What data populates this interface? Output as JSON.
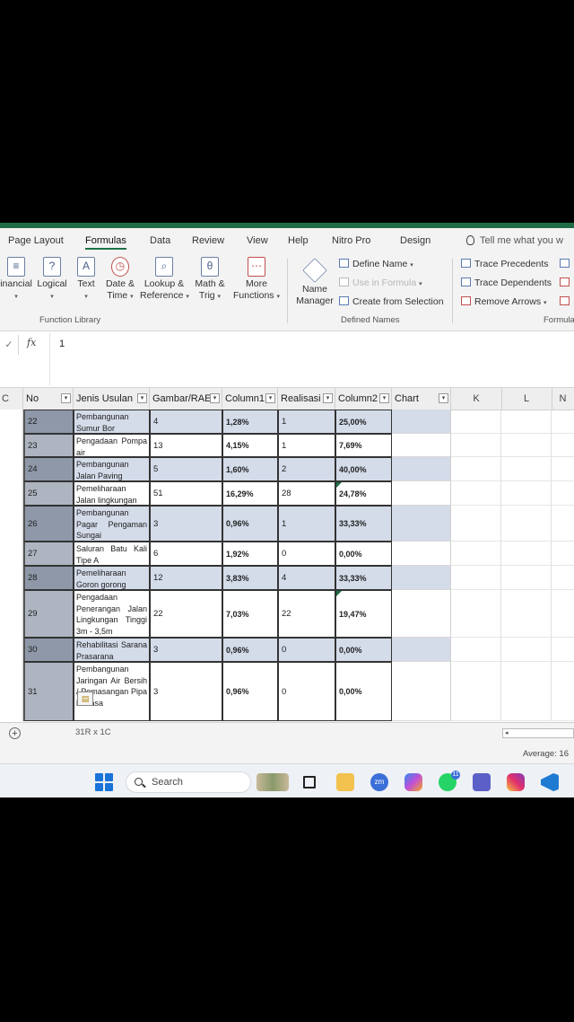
{
  "ribbon_tabs": [
    {
      "label": "Page Layout",
      "active": false
    },
    {
      "label": "Formulas",
      "active": true
    },
    {
      "label": "Data",
      "active": false
    },
    {
      "label": "Review",
      "active": false
    },
    {
      "label": "View",
      "active": false
    },
    {
      "label": "Help",
      "active": false
    },
    {
      "label": "Nitro Pro",
      "active": false
    },
    {
      "label": "Design",
      "active": false
    }
  ],
  "tell_me": "Tell me what you w",
  "function_library": {
    "group_label": "Function Library",
    "buttons": [
      {
        "label": "inancial",
        "sub": "",
        "icon": "financial-icon"
      },
      {
        "label": "Logical",
        "sub": "",
        "icon": "logical-icon"
      },
      {
        "label": "Text",
        "sub": "",
        "icon": "text-icon"
      },
      {
        "label": "Date &",
        "sub": "Time",
        "icon": "date-time-icon"
      },
      {
        "label": "Lookup &",
        "sub": "Reference",
        "icon": "lookup-icon"
      },
      {
        "label": "Math &",
        "sub": "Trig",
        "icon": "math-icon"
      },
      {
        "label": "More",
        "sub": "Functions",
        "icon": "more-functions-icon"
      }
    ]
  },
  "defined_names": {
    "group_label": "Defined Names",
    "name_manager_line1": "Name",
    "name_manager_line2": "Manager",
    "define_name": "Define Name",
    "use_in_formula": "Use in Formula",
    "create_from_selection": "Create from Selection"
  },
  "formula_auditing": {
    "group_label": "Formula",
    "trace_precedents": "Trace Precedents",
    "trace_dependents": "Trace Dependents",
    "remove_arrows": "Remove Arrows"
  },
  "formula_bar": {
    "name_box": "",
    "fx": "fx",
    "value": "1"
  },
  "column_headers": {
    "a": "C",
    "no": "No",
    "jenis": "Jenis Usulan",
    "gambar": "Gambar/RAE",
    "column1": "Column1",
    "realisasi": "Realisasi",
    "column2": "Column2",
    "chart": "Chart",
    "k": "K",
    "l": "L",
    "m": "N"
  },
  "rows": [
    {
      "no": "22",
      "jenis": "Pembangunan Sumur Bor",
      "gambar": "4",
      "column1": "1,28%",
      "realisasi": "1",
      "column2": "25,00%"
    },
    {
      "no": "23",
      "jenis": "Pengadaan Pompa air",
      "gambar": "13",
      "column1": "4,15%",
      "realisasi": "1",
      "column2": "7,69%"
    },
    {
      "no": "24",
      "jenis": "Pembangunan Jalan Paving",
      "gambar": "5",
      "column1": "1,60%",
      "realisasi": "2",
      "column2": "40,00%"
    },
    {
      "no": "25",
      "jenis": "Pemeliharaan Jalan lingkungan",
      "gambar": "51",
      "column1": "16,29%",
      "realisasi": "28",
      "column2": "24,78%"
    },
    {
      "no": "26",
      "jenis": "Pembangunan Pagar Pengaman Sungai",
      "gambar": "3",
      "column1": "0,96%",
      "realisasi": "1",
      "column2": "33,33%"
    },
    {
      "no": "27",
      "jenis": "Saluran Batu Kali Tipe A",
      "gambar": "6",
      "column1": "1,92%",
      "realisasi": "0",
      "column2": "0,00%"
    },
    {
      "no": "28",
      "jenis": "Pemeliharaan Goron gorong",
      "gambar": "12",
      "column1": "3,83%",
      "realisasi": "4",
      "column2": "33,33%"
    },
    {
      "no": "29",
      "jenis": "Pengadaan Penerangan Jalan Lingkungan Tinggi 3m - 3,5m",
      "gambar": "22",
      "column1": "7,03%",
      "realisasi": "22",
      "column2": "19,47%"
    },
    {
      "no": "30",
      "jenis": "Rehabilitasi Sarana Prasarana",
      "gambar": "3",
      "column1": "0,96%",
      "realisasi": "0",
      "column2": "0,00%"
    },
    {
      "no": "31",
      "jenis": "Pembangunan Jaringan Air Bersih / Pemasangan Pipa h Biasa",
      "gambar": "3",
      "column1": "0,96%",
      "realisasi": "0",
      "column2": "0,00%"
    }
  ],
  "selection_size": "31R x 1C",
  "status": {
    "average": "Average: 16"
  },
  "taskbar": {
    "search_label": "Search",
    "whatsapp_badge": "11",
    "zoom_label": "zm"
  },
  "colors": {
    "accent": "#1e7145",
    "band": "#d4dbe9",
    "no_column": "#8e98a8"
  }
}
